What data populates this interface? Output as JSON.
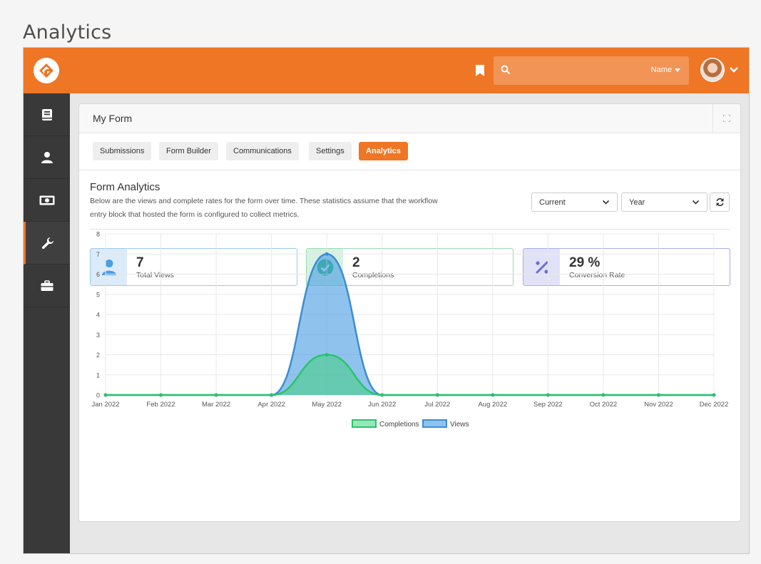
{
  "page_title": "Analytics",
  "header": {
    "search_placeholder": "",
    "search_type": "Name"
  },
  "sidebar": {
    "items": [
      {
        "icon": "book-icon"
      },
      {
        "icon": "person-icon"
      },
      {
        "icon": "money-icon"
      },
      {
        "icon": "wrench-icon",
        "active": true
      },
      {
        "icon": "briefcase-icon"
      }
    ]
  },
  "panel": {
    "title": "My Form",
    "tabs": [
      {
        "label": "Submissions"
      },
      {
        "label": "Form Builder"
      },
      {
        "label": "Communications"
      },
      {
        "label": "Settings"
      },
      {
        "label": "Analytics",
        "active": true
      }
    ]
  },
  "analytics": {
    "title": "Form Analytics",
    "description": "Below are the views and complete rates for the form over time. These statistics assume that the workflow entry block that hosted the form is configured to collect metrics.",
    "period_select": "Current",
    "range_select": "Year"
  },
  "stats": [
    {
      "value": "7",
      "label": "Total Views",
      "icon": "person-icon",
      "color": "#4a9ee3"
    },
    {
      "value": "2",
      "label": "Completions",
      "icon": "check-circle-icon",
      "color": "#2fb865"
    },
    {
      "value": "29 %",
      "label": "Conversion Rate",
      "icon": "percent-icon",
      "color": "#6a6fd8"
    }
  ],
  "colors": {
    "accent": "#ee7625",
    "views": "#3c8dd2",
    "completions": "#2cc36b"
  },
  "chart_data": {
    "type": "area",
    "categories": [
      "Jan 2022",
      "Feb 2022",
      "Mar 2022",
      "Apr 2022",
      "May 2022",
      "Jun 2022",
      "Jul 2022",
      "Aug 2022",
      "Sep 2022",
      "Oct 2022",
      "Nov 2022",
      "Dec 2022"
    ],
    "y_ticks": [
      "0",
      "1",
      "2",
      "3",
      "4",
      "5",
      "6",
      "7",
      "8"
    ],
    "ylim": [
      0,
      8
    ],
    "grid": true,
    "legend_position": "bottom",
    "series": [
      {
        "name": "Completions",
        "values": [
          0,
          0,
          0,
          0,
          2,
          0,
          0,
          0,
          0,
          0,
          0,
          0
        ]
      },
      {
        "name": "Views",
        "values": [
          0,
          0,
          0,
          0,
          7,
          0,
          0,
          0,
          0,
          0,
          0,
          0
        ]
      }
    ]
  }
}
